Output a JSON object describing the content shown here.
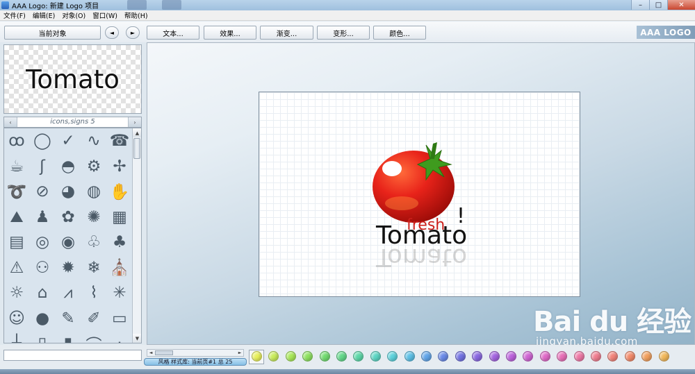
{
  "window": {
    "title": "AAA Logo: 新建 Logo 项目",
    "min_glyph": "–",
    "max_glyph": "□",
    "close_glyph": "✕"
  },
  "menu": [
    "文件(F)",
    "编辑(E)",
    "对象(O)",
    "窗口(W)",
    "帮助(H)"
  ],
  "toolbar": {
    "current_object": "当前对象",
    "prev_glyph": "◄",
    "next_glyph": "►",
    "text_btn": "文本...",
    "effects_btn": "效果...",
    "gradient_btn": "渐变...",
    "transform_btn": "变形...",
    "color_btn": "颜色...",
    "brand": "AAA LOGO"
  },
  "preview": {
    "text": "Tomato"
  },
  "library": {
    "title": "icons,signs 5",
    "left_glyph": "‹",
    "right_glyph": "›",
    "up_glyph": "▲",
    "down_glyph": "▼",
    "icons": [
      {
        "name": "waves-icon",
        "glyph": "ꝏ"
      },
      {
        "name": "swirl-icon",
        "glyph": "◯"
      },
      {
        "name": "swoosh-icon",
        "glyph": "✓"
      },
      {
        "name": "squiggle-icon",
        "glyph": "∿"
      },
      {
        "name": "telephone-icon",
        "glyph": "☎"
      },
      {
        "name": "coffee-cup-icon",
        "glyph": "☕"
      },
      {
        "name": "s-curve-icon",
        "glyph": "ʃ"
      },
      {
        "name": "teacup-icon",
        "glyph": "◓"
      },
      {
        "name": "gears-icon",
        "glyph": "⚙"
      },
      {
        "name": "fan-icon",
        "glyph": "✢"
      },
      {
        "name": "wave-icon",
        "glyph": "➰"
      },
      {
        "name": "no-smoking-icon",
        "glyph": "⊘"
      },
      {
        "name": "globe-icon",
        "glyph": "◕"
      },
      {
        "name": "earth-icon",
        "glyph": "◍"
      },
      {
        "name": "hand-icon",
        "glyph": "✋"
      },
      {
        "name": "turtle-icon",
        "glyph": "⛰"
      },
      {
        "name": "family-icon",
        "glyph": "♟"
      },
      {
        "name": "flower-icon",
        "glyph": "✿"
      },
      {
        "name": "splash-icon",
        "glyph": "✺"
      },
      {
        "name": "brick-wall-icon",
        "glyph": "▦"
      },
      {
        "name": "calculator-icon",
        "glyph": "▤"
      },
      {
        "name": "spiral-icon",
        "glyph": "◎"
      },
      {
        "name": "target-icon",
        "glyph": "◉"
      },
      {
        "name": "xmas-tree-outline-icon",
        "glyph": "♧"
      },
      {
        "name": "xmas-tree-icon",
        "glyph": "♣"
      },
      {
        "name": "warning-icon",
        "glyph": "⚠"
      },
      {
        "name": "handshake-icon",
        "glyph": "⚇"
      },
      {
        "name": "fire-icon",
        "glyph": "✹"
      },
      {
        "name": "snowflake-icon",
        "glyph": "❄"
      },
      {
        "name": "church-icon",
        "glyph": "⛪"
      },
      {
        "name": "sun-house-icon",
        "glyph": "☼"
      },
      {
        "name": "house-icon",
        "glyph": "⌂"
      },
      {
        "name": "wings-icon",
        "glyph": "⩘"
      },
      {
        "name": "bird-icon",
        "glyph": "⌇"
      },
      {
        "name": "palm-tree-icon",
        "glyph": "✳"
      },
      {
        "name": "face-icon",
        "glyph": "☺"
      },
      {
        "name": "bomb-icon",
        "glyph": "●"
      },
      {
        "name": "paint-bucket-icon",
        "glyph": "✎"
      },
      {
        "name": "brush-icon",
        "glyph": "✐"
      },
      {
        "name": "bus-icon",
        "glyph": "▭"
      },
      {
        "name": "cross-icon",
        "glyph": "┼"
      },
      {
        "name": "bottle-icon",
        "glyph": "▯"
      },
      {
        "name": "jar-icon",
        "glyph": "▮"
      },
      {
        "name": "arc-icon",
        "glyph": "⌒"
      },
      {
        "name": "blank-icon",
        "glyph": "·"
      }
    ]
  },
  "artboard": {
    "logo_script": "fresh",
    "logo_word": "Tomato",
    "logo_bang": "!"
  },
  "watermark": {
    "logo": "Bai du 经验",
    "url": "jingyan.baidu.com"
  },
  "status": {
    "text": "风格  样式库: 当前页#1  总  25",
    "left_glyph": "◄",
    "right_glyph": "►"
  },
  "swatches": [
    "#e8f05a",
    "#c9ec5c",
    "#a8e858",
    "#8ee260",
    "#72dc70",
    "#62d88a",
    "#5cd8a8",
    "#5cd6c4",
    "#5cd2dc",
    "#5cc0e6",
    "#62a6ea",
    "#6a8ae8",
    "#7272e2",
    "#8a68e2",
    "#a464e0",
    "#bc62dc",
    "#d064d4",
    "#e06ac8",
    "#e870b8",
    "#ee78a6",
    "#f07e90",
    "#f2847a",
    "#f28a6a",
    "#f2a05e",
    "#f2b85a"
  ],
  "colors": {
    "tomato_red": "#d41a12",
    "leaf_green": "#3f9b1e",
    "script_red": "#cc1f1a"
  }
}
